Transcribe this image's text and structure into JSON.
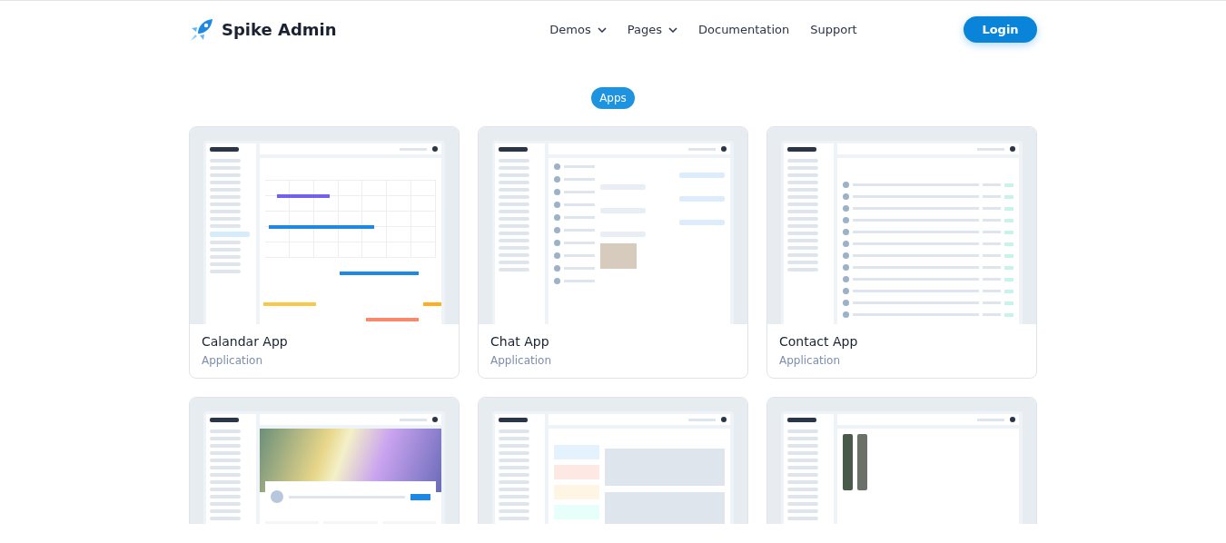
{
  "header": {
    "brand": "Spike Admin",
    "nav": [
      {
        "label": "Demos",
        "dropdown": true
      },
      {
        "label": "Pages",
        "dropdown": true
      },
      {
        "label": "Documentation",
        "dropdown": false
      },
      {
        "label": "Support",
        "dropdown": false
      }
    ],
    "login": "Login"
  },
  "section_badge": "Apps",
  "cards": [
    {
      "kind": "calendar",
      "title": "Calandar App",
      "subtitle": "Application"
    },
    {
      "kind": "chat",
      "title": "Chat App",
      "subtitle": "Application"
    },
    {
      "kind": "contacts",
      "title": "Contact App",
      "subtitle": "Application"
    },
    {
      "kind": "profile"
    },
    {
      "kind": "notes"
    },
    {
      "kind": "blog"
    }
  ]
}
